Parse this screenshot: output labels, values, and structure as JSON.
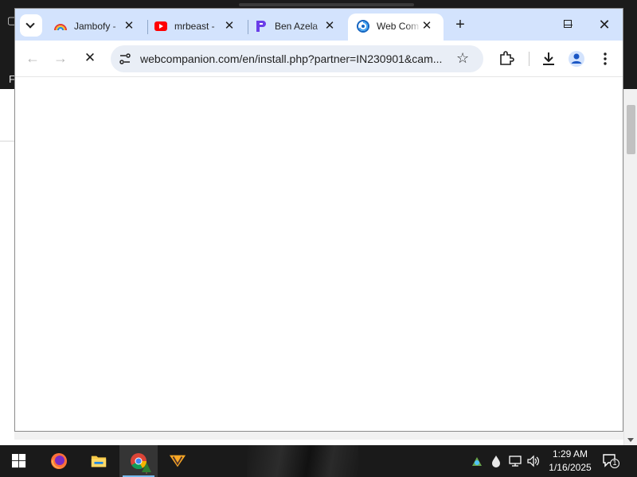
{
  "browser": {
    "tabs": [
      {
        "title": "Jambofy -",
        "favicon": "rainbow-icon"
      },
      {
        "title": "mrbeast -",
        "favicon": "youtube-icon"
      },
      {
        "title": "Ben Azela",
        "favicon": "p-logo-icon"
      },
      {
        "title": "Web Com",
        "favicon": "web-companion-icon",
        "active": true
      }
    ],
    "url": "webcompanion.com/en/install.php?partner=IN230901&cam...",
    "status": "loading"
  },
  "taskbar": {
    "time": "1:29 AM",
    "date": "1/16/2025",
    "notification_count": "1",
    "pinned": [
      "firefox-icon",
      "file-explorer-icon",
      "chrome-icon",
      "winamp-icon"
    ],
    "active_app": "chrome-icon"
  },
  "colors": {
    "tabbar": "#d3e3fd",
    "omnibox": "#e9eef6",
    "taskbar": "#1a1a1a",
    "accent": "#76b9ed"
  }
}
